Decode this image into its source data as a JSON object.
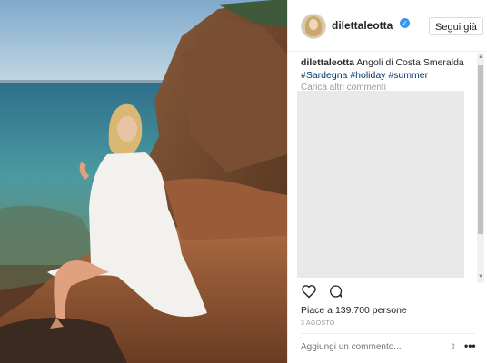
{
  "post": {
    "username": "dilettaleotta",
    "follow_label": "Segui già",
    "caption_user": "dilettaleotta",
    "caption_text": "Angoli di Costa Smeralda",
    "hashtags": [
      "#Sardegna",
      "#holiday",
      "#summer"
    ],
    "load_more_label": "Carica altri commenti",
    "likes_text": "Piace a 139.700 persone",
    "date_text": "3 AGOSTO",
    "comment_placeholder": "Aggiungi un commento..."
  },
  "icons": {
    "verified": "verified-badge-icon",
    "like": "heart-icon",
    "comment": "comment-icon",
    "more": "more-options-icon"
  },
  "colors": {
    "verified": "#3897f0",
    "hashtag": "#003569"
  }
}
